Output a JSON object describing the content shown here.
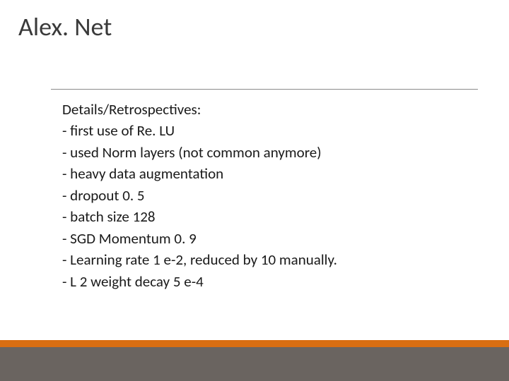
{
  "title": "Alex. Net",
  "content": {
    "heading": "Details/Retrospectives:",
    "bullets": [
      "- first use of Re. LU",
      "- used Norm layers (not common anymore)",
      "- heavy data augmentation",
      "- dropout 0. 5",
      "- batch size 128",
      "- SGD Momentum 0. 9",
      "- Learning rate 1 e-2, reduced by 10 manually.",
      "- L 2 weight decay 5 e-4"
    ]
  }
}
